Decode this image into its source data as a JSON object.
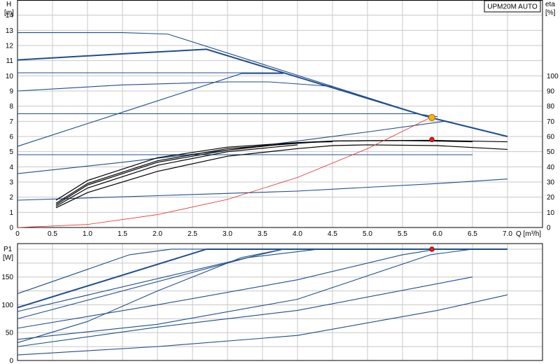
{
  "chart_data": [
    {
      "type": "line",
      "title": "UPM20M AUTO",
      "xlabel": "Q [m³/h]",
      "ylabel_left_name": "H",
      "ylabel_left_unit": "[m]",
      "ylabel_right_name": "eta",
      "ylabel_right_unit": "[%]",
      "xlim": [
        0,
        7.5
      ],
      "ylim": [
        0,
        15
      ],
      "ylim_right": [
        0,
        150
      ],
      "x_ticks": [
        "0",
        "0.5",
        "1.0",
        "1.5",
        "2.0",
        "2.5",
        "3.0",
        "3.5",
        "4.0",
        "4.5",
        "5.0",
        "5.5",
        "6.0",
        "6.5",
        "7.0"
      ],
      "y_ticks": [
        "0",
        "1",
        "2",
        "3",
        "4",
        "5",
        "6",
        "7",
        "8",
        "9",
        "10",
        "11",
        "12",
        "13",
        "14"
      ],
      "y_ticks_right": [
        "0",
        "10",
        "20",
        "30",
        "40",
        "50",
        "60",
        "70",
        "80",
        "90",
        "100"
      ],
      "grid": true,
      "series": [
        {
          "role": "head",
          "bold": false,
          "x": [
            0,
            1.5,
            2.15,
            5.9,
            7.0
          ],
          "y": [
            12.85,
            12.85,
            12.75,
            7.25,
            6.0
          ]
        },
        {
          "role": "head",
          "bold": true,
          "x": [
            0,
            1.5,
            2.7,
            5.9,
            7.0
          ],
          "y": [
            11.05,
            11.45,
            11.75,
            7.25,
            6.0
          ]
        },
        {
          "role": "head",
          "bold": false,
          "x": [
            0,
            3.8
          ],
          "y": [
            10.2,
            10.2
          ]
        },
        {
          "role": "head",
          "bold": false,
          "x": [
            0,
            1.5,
            3.0,
            3.6,
            4.5
          ],
          "y": [
            9.0,
            9.4,
            9.6,
            9.6,
            9.3
          ]
        },
        {
          "role": "head",
          "bold": false,
          "x": [
            0,
            1.5,
            3.2,
            3.8
          ],
          "y": [
            5.35,
            7.6,
            10.15,
            10.15
          ]
        },
        {
          "role": "head",
          "bold": false,
          "x": [
            0,
            5.7,
            6.0
          ],
          "y": [
            7.5,
            7.5,
            7.3
          ]
        },
        {
          "role": "head",
          "bold": false,
          "x": [
            0,
            1.5,
            3.0,
            5.0,
            6.1,
            7.0
          ],
          "y": [
            3.55,
            4.3,
            5.1,
            6.3,
            7.0,
            6.0
          ]
        },
        {
          "role": "head",
          "bold": false,
          "x": [
            0,
            6.5
          ],
          "y": [
            4.8,
            4.8
          ]
        },
        {
          "role": "head",
          "bold": false,
          "x": [
            0,
            2.0,
            4.0,
            6.0,
            7.0
          ],
          "y": [
            1.8,
            2.1,
            2.4,
            2.9,
            3.2
          ]
        },
        {
          "role": "efficiency",
          "x": [
            0.55,
            1.0,
            2.0,
            3.0,
            4.0,
            4.5,
            5.0,
            5.9,
            7.0
          ],
          "y": [
            15,
            28,
            43,
            51,
            56,
            57,
            57.3,
            57.5,
            56.5
          ]
        },
        {
          "role": "efficiency",
          "x": [
            0.55,
            1.0,
            2.0,
            3.0,
            4.0,
            4.5,
            5.0,
            5.5,
            6.0,
            6.5
          ],
          "y": [
            16,
            29,
            44,
            52,
            55.5,
            57,
            57.2,
            57.3,
            57.0,
            56.5
          ]
        },
        {
          "role": "efficiency",
          "x": [
            0.55,
            1.0,
            2.0,
            3.0,
            4.0,
            4.5,
            5.0,
            6.0,
            7.0
          ],
          "y": [
            13,
            23,
            37,
            47,
            52,
            54,
            54.5,
            54,
            51.5
          ]
        },
        {
          "role": "efficiency",
          "x": [
            0.55,
            1.0,
            2.0,
            3.0,
            4.0,
            4.5
          ],
          "y": [
            18,
            31,
            46,
            53,
            56,
            56.5
          ]
        },
        {
          "role": "efficiency",
          "x": [
            0.55,
            1.0,
            2.0,
            3.0,
            4.0
          ],
          "y": [
            14,
            26,
            41,
            50,
            54.5
          ]
        },
        {
          "role": "system",
          "x": [
            0,
            1.0,
            2.0,
            3.0,
            4.0,
            5.0,
            5.9
          ],
          "y": [
            0,
            0.2,
            0.85,
            1.85,
            3.3,
            5.2,
            7.25
          ]
        }
      ],
      "markers": [
        {
          "x": 5.92,
          "y": 7.25,
          "color": "#f5b400",
          "label": "duty point"
        },
        {
          "x": 5.92,
          "y": 5.8,
          "color": "#e02020",
          "label": "efficiency point"
        }
      ]
    },
    {
      "type": "line",
      "xlabel": "",
      "ylabel_name": "P1",
      "ylabel_unit": "[W]",
      "xlim": [
        0,
        7.5
      ],
      "ylim": [
        0,
        210
      ],
      "y_ticks": [
        "0",
        "50",
        "100",
        "150"
      ],
      "grid": true,
      "series": [
        {
          "bold": false,
          "x": [
            0,
            1.6,
            2.2,
            7.0
          ],
          "y": [
            120,
            190,
            200,
            200
          ]
        },
        {
          "bold": true,
          "x": [
            0,
            2.7,
            7.0
          ],
          "y": [
            95,
            200,
            200
          ]
        },
        {
          "bold": false,
          "x": [
            0,
            3.8
          ],
          "y": [
            88,
            200
          ]
        },
        {
          "bold": false,
          "x": [
            0,
            3.3,
            4.3
          ],
          "y": [
            75,
            185,
            200
          ]
        },
        {
          "bold": false,
          "x": [
            0,
            1.0,
            2.0,
            3.2,
            3.8
          ],
          "y": [
            32,
            70,
            125,
            185,
            200
          ]
        },
        {
          "bold": false,
          "x": [
            0,
            2.0,
            4.0,
            5.5,
            6.0
          ],
          "y": [
            58,
            100,
            145,
            190,
            200
          ]
        },
        {
          "bold": false,
          "x": [
            0,
            2.0,
            4.0,
            5.9,
            6.5
          ],
          "y": [
            38,
            65,
            110,
            190,
            200
          ]
        },
        {
          "bold": false,
          "x": [
            0,
            2.0,
            4.0,
            6.5
          ],
          "y": [
            25,
            60,
            90,
            150
          ]
        },
        {
          "bold": false,
          "x": [
            0,
            2.0,
            4.0,
            6.0,
            7.0
          ],
          "y": [
            10,
            25,
            45,
            90,
            118
          ]
        }
      ],
      "markers": [
        {
          "x": 5.92,
          "y": 200,
          "color": "#e02020",
          "label": "power point"
        }
      ]
    }
  ]
}
